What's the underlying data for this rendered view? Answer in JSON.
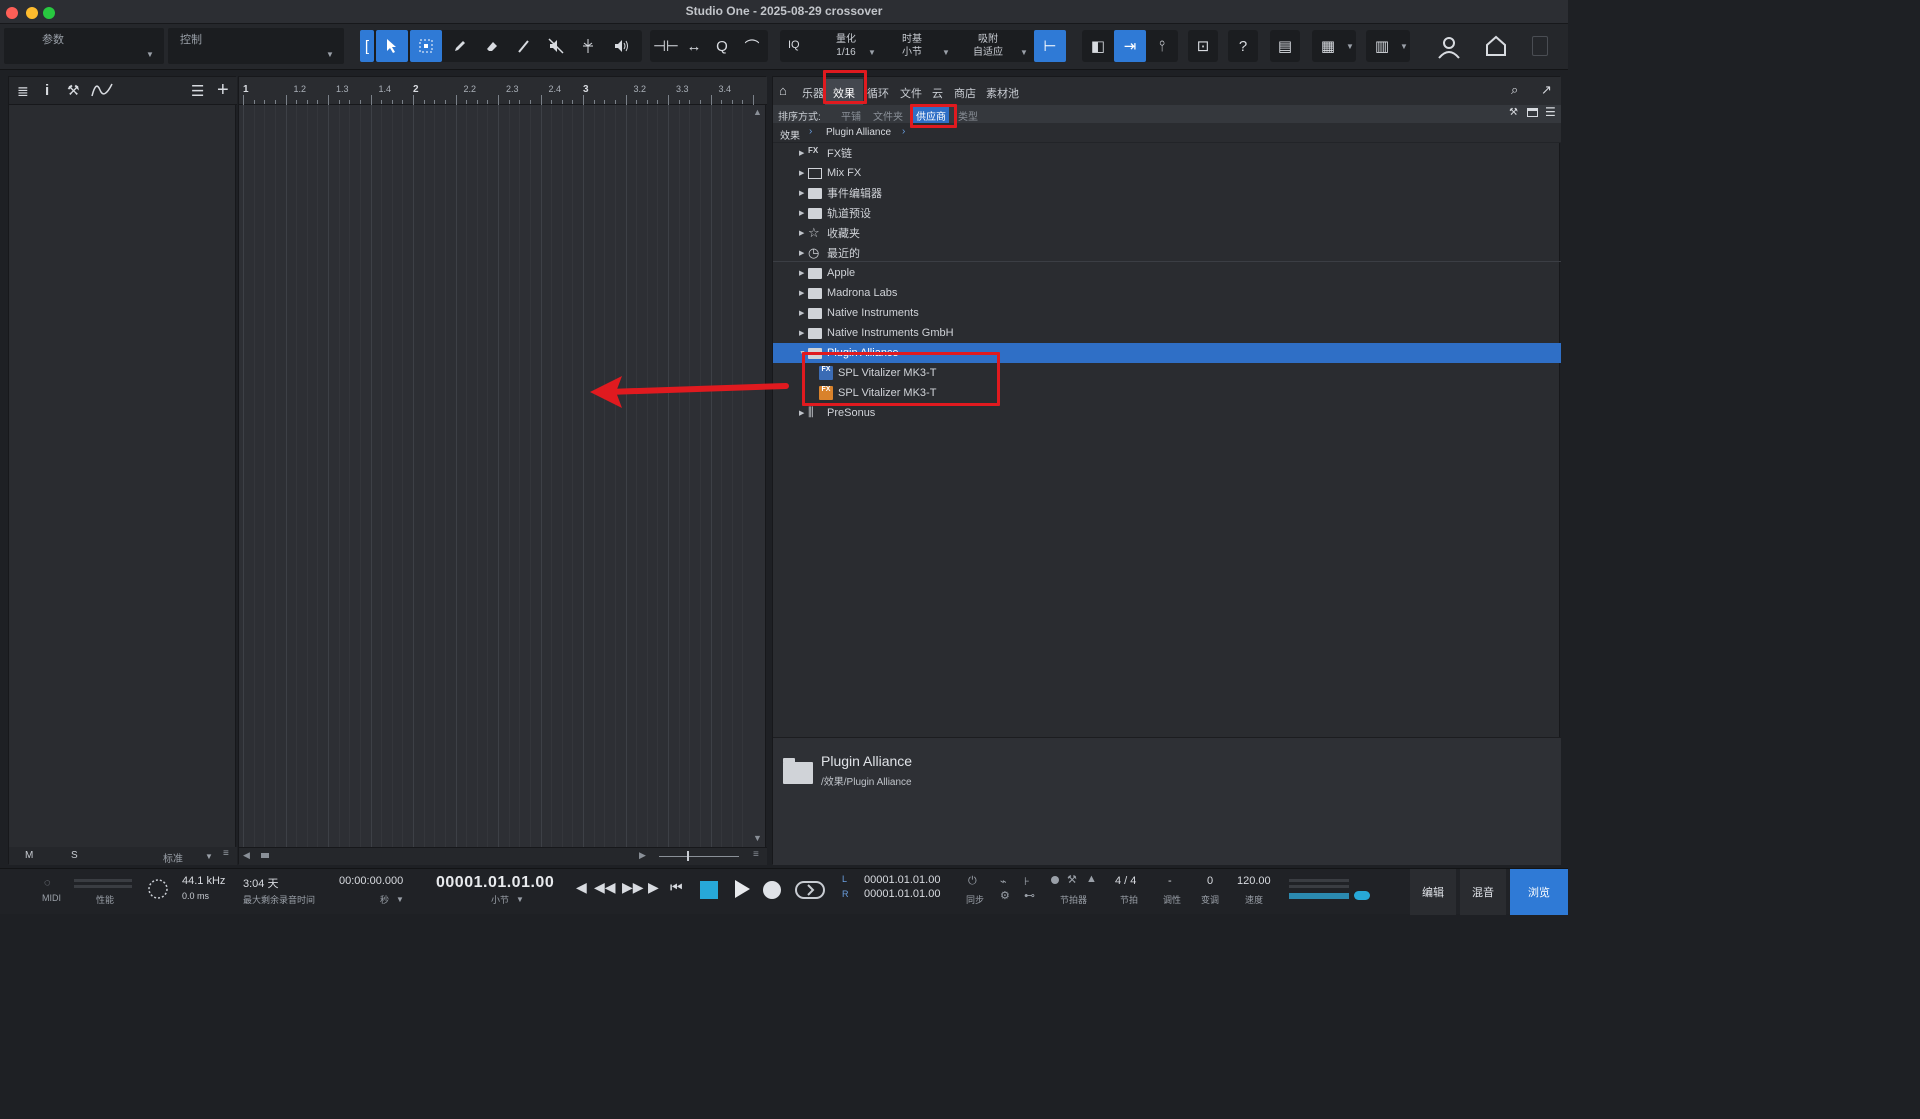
{
  "window": {
    "title": "Studio One - 2025-08-29 crossover"
  },
  "toolbar": {
    "param_label": "参数",
    "control_label": "控制",
    "iq_label": "IQ",
    "quantize_label": "量化",
    "quantize_value": "1/16",
    "timebase_label": "时基",
    "timebase_value": "小节",
    "snap_label": "吸附",
    "snap_value": "自适应",
    "help_label": "?"
  },
  "inspector": {
    "footer_m": "M",
    "footer_s": "S",
    "footer_mode": "标准"
  },
  "ruler": {
    "ticks": [
      "1",
      "1.2",
      "1.3",
      "1.4",
      "2",
      "2.2",
      "2.3",
      "2.4",
      "3",
      "3.2",
      "3.3",
      "3.4"
    ]
  },
  "browser": {
    "tabs": [
      "乐器",
      "效果",
      "循环",
      "文件",
      "云",
      "商店",
      "素材池"
    ],
    "active_tab": "效果",
    "sort_label": "排序方式:",
    "sort_options": [
      "平铺",
      "文件夹",
      "供应商",
      "类型"
    ],
    "active_sort": "供应商",
    "path": [
      "效果",
      "Plugin Alliance"
    ],
    "tree": [
      {
        "label": "FX链",
        "icon": "fx-chain-icon"
      },
      {
        "label": "Mix FX",
        "icon": "mixfx-icon"
      },
      {
        "label": "事件编辑器",
        "icon": "folder-icon"
      },
      {
        "label": "轨道预设",
        "icon": "folder-icon"
      },
      {
        "label": "收藏夹",
        "icon": "star-icon"
      },
      {
        "label": "最近的",
        "icon": "clock-icon"
      },
      {
        "label": "Apple",
        "icon": "folder-icon"
      },
      {
        "label": "Madrona Labs",
        "icon": "folder-icon"
      },
      {
        "label": "Native Instruments",
        "icon": "folder-icon"
      },
      {
        "label": "Native Instruments GmbH",
        "icon": "folder-icon"
      },
      {
        "label": "Plugin Alliance",
        "icon": "folder-icon",
        "selected": true,
        "expanded": true
      },
      {
        "label": "SPL Vitalizer MK3-T",
        "icon": "vst-plugin-icon",
        "child": true
      },
      {
        "label": "SPL Vitalizer MK3-T",
        "icon": "au-plugin-icon",
        "child": true
      },
      {
        "label": "PreSonus",
        "icon": "presonus-icon"
      }
    ],
    "info": {
      "name": "Plugin Alliance",
      "path": "/效果/Plugin Alliance"
    }
  },
  "transport": {
    "midi_label": "MIDI",
    "perf_label": "性能",
    "sample_rate": "44.1 kHz",
    "latency": "0.0 ms",
    "record_time": "3:04 天",
    "record_time_label": "最大剩余录音时间",
    "time_seconds": "00:00:00.000",
    "time_seconds_label": "秒",
    "position_bars": "00001.01.01.00",
    "position_bars_label": "小节",
    "loop_l": "00001.01.01.00",
    "loop_r": "00001.01.01.00",
    "loop_l_label": "L",
    "loop_r_label": "R",
    "sync_label": "同步",
    "metronome_label": "节拍器",
    "time_sig": "4 / 4",
    "time_sig_label": "节拍",
    "key": "-",
    "key_label": "调性",
    "transpose": "0",
    "transpose_label": "变调",
    "tempo": "120.00",
    "tempo_label": "速度"
  },
  "views": {
    "edit": "编辑",
    "mix": "混音",
    "browse": "浏览"
  },
  "colors": {
    "accent": "#2f7ad6",
    "selection": "#2f6fc6",
    "annotation": "#e01a1f"
  }
}
